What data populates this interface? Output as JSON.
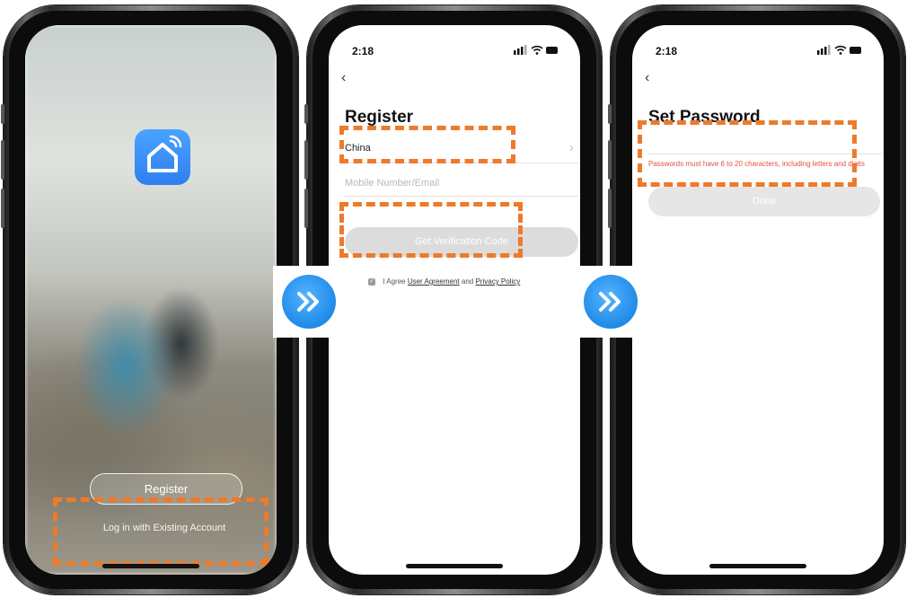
{
  "phone1": {
    "register_label": "Register",
    "login_label": "Log in with Existing Account"
  },
  "phone2": {
    "time": "2:18",
    "back": "‹",
    "title": "Register",
    "country": "China",
    "country_chevron": "›",
    "account_placeholder": "Mobile Number/Email",
    "get_code_label": "Get Verification Code",
    "agree_prefix": "I Agree",
    "user_agreement": "User Agreement",
    "and": "and",
    "privacy_policy": "Privacy Policy"
  },
  "phone3": {
    "time": "2:18",
    "back": "‹",
    "title": "Set Password",
    "hint": "Passwords must have 6 to 20 characters, including letters and digits",
    "done_label": "Done"
  },
  "arrows": {
    "glyph": "»"
  },
  "colors": {
    "highlight": "#ee7a2a",
    "accent_blue": "#2f8ceb",
    "hint_red": "#e2503f",
    "disabled_button": "#dcdcdc"
  }
}
